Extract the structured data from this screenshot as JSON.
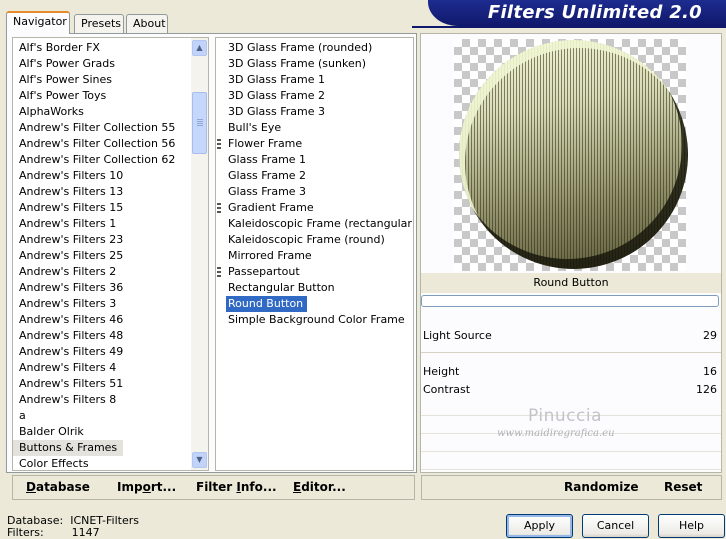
{
  "tabs": [
    "Navigator",
    "Presets",
    "About"
  ],
  "title": "Filters Unlimited 2.0",
  "categories": [
    "Alf's Border FX",
    "Alf's Power Grads",
    "Alf's Power Sines",
    "Alf's Power Toys",
    "AlphaWorks",
    "Andrew's Filter Collection 55",
    "Andrew's Filter Collection 56",
    "Andrew's Filter Collection 62",
    "Andrew's Filters 10",
    "Andrew's Filters 13",
    "Andrew's Filters 15",
    "Andrew's Filters 1",
    "Andrew's Filters 23",
    "Andrew's Filters 25",
    "Andrew's Filters 2",
    "Andrew's Filters 36",
    "Andrew's Filters 3",
    "Andrew's Filters 46",
    "Andrew's Filters 48",
    "Andrew's Filters 49",
    "Andrew's Filters 4",
    "Andrew's Filters 51",
    "Andrew's Filters 8",
    "a",
    "Balder Olrik",
    "Buttons & Frames",
    "Color Effects"
  ],
  "selected_category": "Buttons & Frames",
  "filters": [
    {
      "label": "3D Glass Frame (rounded)",
      "grip": false
    },
    {
      "label": "3D Glass Frame (sunken)",
      "grip": false
    },
    {
      "label": "3D Glass Frame 1",
      "grip": false
    },
    {
      "label": "3D Glass Frame 2",
      "grip": false
    },
    {
      "label": "3D Glass Frame 3",
      "grip": false
    },
    {
      "label": "Bull's Eye",
      "grip": false
    },
    {
      "label": "Flower Frame",
      "grip": true
    },
    {
      "label": "Glass Frame 1",
      "grip": false
    },
    {
      "label": "Glass Frame 2",
      "grip": false
    },
    {
      "label": "Glass Frame 3",
      "grip": false
    },
    {
      "label": "Gradient Frame",
      "grip": true
    },
    {
      "label": "Kaleidoscopic Frame (rectangular)",
      "grip": false
    },
    {
      "label": "Kaleidoscopic Frame (round)",
      "grip": false
    },
    {
      "label": "Mirrored Frame",
      "grip": false
    },
    {
      "label": "Passepartout",
      "grip": true
    },
    {
      "label": "Rectangular Button",
      "grip": false
    },
    {
      "label": "Round Button",
      "grip": false
    },
    {
      "label": "Simple Background Color Frame",
      "grip": false
    }
  ],
  "selected_filter": "Round Button",
  "preview": {
    "filter_name": "Round Button"
  },
  "params": [
    {
      "label": "Light Source",
      "value": "29"
    },
    {
      "label": "Height",
      "value": "16"
    },
    {
      "label": "Contrast",
      "value": "126"
    }
  ],
  "watermark": {
    "line1": "Pinuccia",
    "line2": "www.maidiregrafica.eu"
  },
  "left_buttons": {
    "database": {
      "u": "D",
      "rest": "atabase"
    },
    "import": {
      "pre": "Imp",
      "u": "o",
      "rest": "rt..."
    },
    "filter_info": {
      "pre": "Filter ",
      "u": "I",
      "rest": "nfo..."
    },
    "editor": {
      "u": "E",
      "rest": "ditor..."
    }
  },
  "right_buttons": {
    "randomize": "Randomize",
    "reset": "Reset"
  },
  "status": {
    "database_label": "Database:",
    "database_value": "ICNET-Filters",
    "filters_label": "Filters:",
    "filters_value": "1147"
  },
  "dialog_buttons": {
    "apply": "Apply",
    "cancel": "Cancel",
    "help": "Help"
  },
  "colors": {
    "banner": "#10186b",
    "selection": "#316ac5",
    "tab_accent": "#e68b2c"
  }
}
